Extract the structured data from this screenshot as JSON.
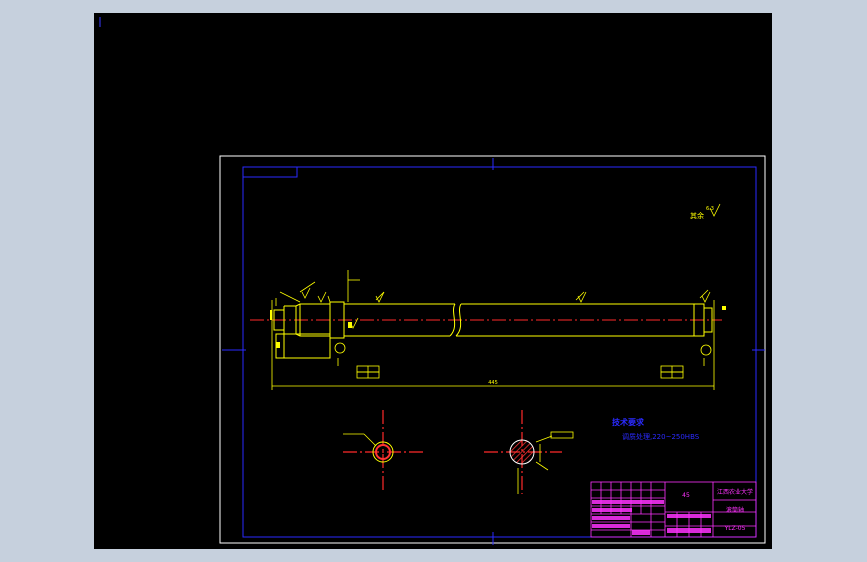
{
  "colors": {
    "background": "#c6d0dd",
    "model_space": "#000000",
    "frame": "#ffffff",
    "border": "#2a2aff",
    "part_outline": "#ffff00",
    "centerline": "#ff2a2a",
    "section_hatch": "#ff3333",
    "notes_text": "#2a2aff",
    "title_block": "#ff33ff"
  },
  "drawing": {
    "roughness_label": "其余",
    "roughness_value": "6.3",
    "tech_requirements": {
      "heading": "技术要求",
      "line1": "调质处理,220~250HBS"
    },
    "overall_length": "445",
    "title_block": {
      "material": "45",
      "school": "江西农业大学",
      "part_name": "滚筒轴",
      "drawing_no": "YLZ-05"
    }
  }
}
